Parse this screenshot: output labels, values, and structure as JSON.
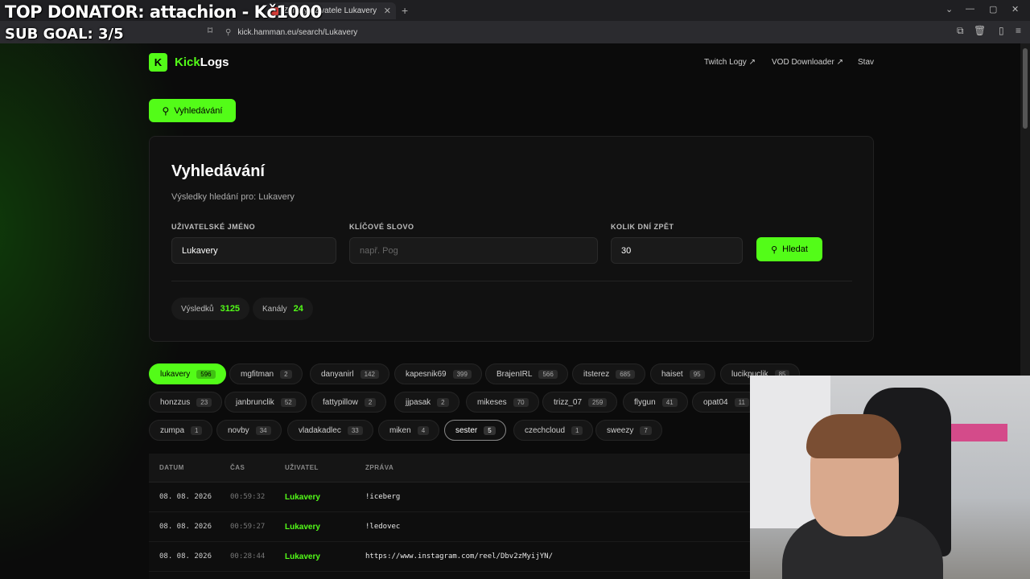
{
  "browser": {
    "tab_title": "Zprávy uživatele Lukavery – Kick",
    "url": "kick.hamman.eu/search/Lukavery"
  },
  "overlay": {
    "donator": "TOP DONATOR: attachion - Kč1000",
    "sub_goal": "SUB GOAL: 3/5"
  },
  "site": {
    "logo_letter": "K",
    "logo_accent": "Kick",
    "logo_rest": "Logs",
    "nav": [
      "Twitch Logy",
      "VOD Downloader",
      "Stav"
    ]
  },
  "search_button": "Vyhledávání",
  "card": {
    "title": "Vyhledávání",
    "subtitle": "Výsledky hledání pro: Lukavery",
    "fields": {
      "username_label": "UŽIVATELSKÉ JMÉNO",
      "username_value": "Lukavery",
      "keyword_label": "KLÍČOVÉ SLOVO",
      "keyword_placeholder": "např. Pog",
      "days_label": "KOLIK DNÍ ZPĚT",
      "days_value": "30"
    },
    "submit": "Hledat",
    "stats": {
      "results_label": "Výsledků",
      "results_value": "3125",
      "channels_label": "Kanály",
      "channels_value": "24"
    }
  },
  "channels": [
    {
      "name": "lukavery",
      "count": "596"
    },
    {
      "name": "mgfitman",
      "count": "2"
    },
    {
      "name": "danyanirl",
      "count": "142"
    },
    {
      "name": "kapesnik69",
      "count": "399"
    },
    {
      "name": "BrajenIRL",
      "count": "566"
    },
    {
      "name": "itsterez",
      "count": "685"
    },
    {
      "name": "haiset",
      "count": "95"
    },
    {
      "name": "lucikpuclik",
      "count": "85"
    },
    {
      "name": "honzzus",
      "count": "23"
    },
    {
      "name": "janbrunclik",
      "count": "52"
    },
    {
      "name": "fattypillow",
      "count": "2"
    },
    {
      "name": "jjpasak",
      "count": "2"
    },
    {
      "name": "mikeses",
      "count": "70"
    },
    {
      "name": "trizz_07",
      "count": "259"
    },
    {
      "name": "flygun",
      "count": "41"
    },
    {
      "name": "opat04",
      "count": "11"
    },
    {
      "name": "zumpa",
      "count": "1"
    },
    {
      "name": "novby",
      "count": "34"
    },
    {
      "name": "vladakadlec",
      "count": "33"
    },
    {
      "name": "miken",
      "count": "4"
    },
    {
      "name": "sester",
      "count": "5"
    },
    {
      "name": "czechcloud",
      "count": "1"
    },
    {
      "name": "sweezy",
      "count": "7"
    }
  ],
  "table": {
    "headers": [
      "DATUM",
      "ČAS",
      "UŽIVATEL",
      "ZPRÁVA"
    ],
    "rows": [
      {
        "date": "08. 08. 2026",
        "time": "00:59:32",
        "user": "Lukavery",
        "message": "!iceberg"
      },
      {
        "date": "08. 08. 2026",
        "time": "00:59:27",
        "user": "Lukavery",
        "message": "!ledovec"
      },
      {
        "date": "08. 08. 2026",
        "time": "00:28:44",
        "user": "Lukavery",
        "message": "https://www.instagram.com/reel/Dbv2zMyijYN/"
      }
    ]
  },
  "colors": {
    "accent": "#53fc18",
    "bg": "#0b0b0b",
    "card": "#111111"
  }
}
